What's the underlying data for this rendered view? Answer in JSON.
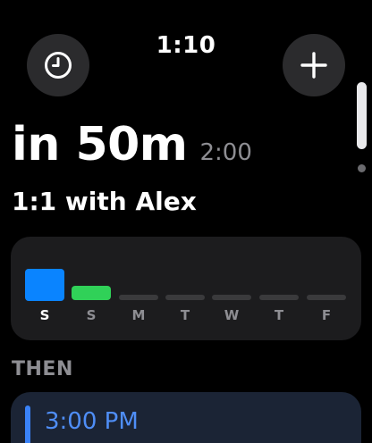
{
  "status": {
    "time": "1:10"
  },
  "header": {
    "left_button_icon": "clock-icon",
    "right_button_icon": "plus-icon"
  },
  "current_event": {
    "relative_time": "in 50m",
    "start_time": "2:00",
    "title": "1:1 with Alex"
  },
  "week": {
    "days": [
      {
        "label": "S",
        "color": "#0a84ff",
        "is_today": true
      },
      {
        "label": "S",
        "color": "#30d158",
        "is_today": false
      },
      {
        "label": "M",
        "color": "#3a3a3c",
        "is_today": false
      },
      {
        "label": "T",
        "color": "#3a3a3c",
        "is_today": false
      },
      {
        "label": "W",
        "color": "#3a3a3c",
        "is_today": false
      },
      {
        "label": "T",
        "color": "#3a3a3c",
        "is_today": false
      },
      {
        "label": "F",
        "color": "#3a3a3c",
        "is_today": false
      }
    ]
  },
  "then": {
    "heading": "THEN",
    "next_time": "3:00 PM",
    "accent_color": "#3a82f7"
  }
}
